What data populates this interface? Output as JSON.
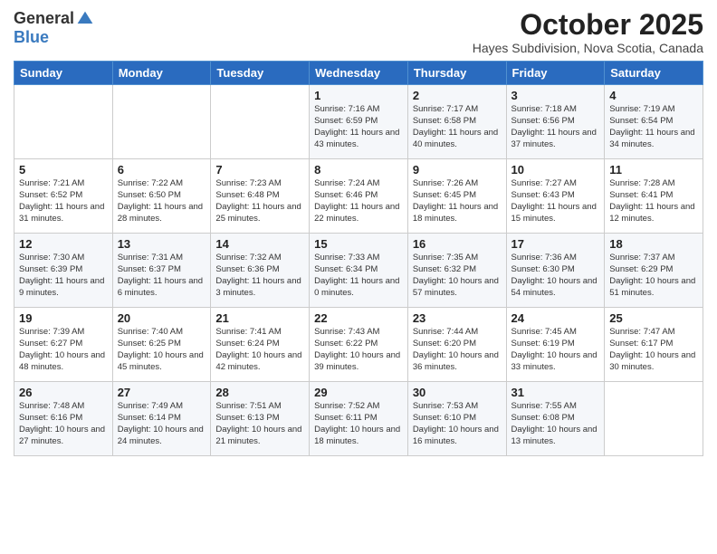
{
  "logo": {
    "general": "General",
    "blue": "Blue"
  },
  "title": "October 2025",
  "subtitle": "Hayes Subdivision, Nova Scotia, Canada",
  "days_of_week": [
    "Sunday",
    "Monday",
    "Tuesday",
    "Wednesday",
    "Thursday",
    "Friday",
    "Saturday"
  ],
  "weeks": [
    [
      {
        "day": "",
        "info": ""
      },
      {
        "day": "",
        "info": ""
      },
      {
        "day": "",
        "info": ""
      },
      {
        "day": "1",
        "info": "Sunrise: 7:16 AM\nSunset: 6:59 PM\nDaylight: 11 hours\nand 43 minutes."
      },
      {
        "day": "2",
        "info": "Sunrise: 7:17 AM\nSunset: 6:58 PM\nDaylight: 11 hours\nand 40 minutes."
      },
      {
        "day": "3",
        "info": "Sunrise: 7:18 AM\nSunset: 6:56 PM\nDaylight: 11 hours\nand 37 minutes."
      },
      {
        "day": "4",
        "info": "Sunrise: 7:19 AM\nSunset: 6:54 PM\nDaylight: 11 hours\nand 34 minutes."
      }
    ],
    [
      {
        "day": "5",
        "info": "Sunrise: 7:21 AM\nSunset: 6:52 PM\nDaylight: 11 hours\nand 31 minutes."
      },
      {
        "day": "6",
        "info": "Sunrise: 7:22 AM\nSunset: 6:50 PM\nDaylight: 11 hours\nand 28 minutes."
      },
      {
        "day": "7",
        "info": "Sunrise: 7:23 AM\nSunset: 6:48 PM\nDaylight: 11 hours\nand 25 minutes."
      },
      {
        "day": "8",
        "info": "Sunrise: 7:24 AM\nSunset: 6:46 PM\nDaylight: 11 hours\nand 22 minutes."
      },
      {
        "day": "9",
        "info": "Sunrise: 7:26 AM\nSunset: 6:45 PM\nDaylight: 11 hours\nand 18 minutes."
      },
      {
        "day": "10",
        "info": "Sunrise: 7:27 AM\nSunset: 6:43 PM\nDaylight: 11 hours\nand 15 minutes."
      },
      {
        "day": "11",
        "info": "Sunrise: 7:28 AM\nSunset: 6:41 PM\nDaylight: 11 hours\nand 12 minutes."
      }
    ],
    [
      {
        "day": "12",
        "info": "Sunrise: 7:30 AM\nSunset: 6:39 PM\nDaylight: 11 hours\nand 9 minutes."
      },
      {
        "day": "13",
        "info": "Sunrise: 7:31 AM\nSunset: 6:37 PM\nDaylight: 11 hours\nand 6 minutes."
      },
      {
        "day": "14",
        "info": "Sunrise: 7:32 AM\nSunset: 6:36 PM\nDaylight: 11 hours\nand 3 minutes."
      },
      {
        "day": "15",
        "info": "Sunrise: 7:33 AM\nSunset: 6:34 PM\nDaylight: 11 hours\nand 0 minutes."
      },
      {
        "day": "16",
        "info": "Sunrise: 7:35 AM\nSunset: 6:32 PM\nDaylight: 10 hours\nand 57 minutes."
      },
      {
        "day": "17",
        "info": "Sunrise: 7:36 AM\nSunset: 6:30 PM\nDaylight: 10 hours\nand 54 minutes."
      },
      {
        "day": "18",
        "info": "Sunrise: 7:37 AM\nSunset: 6:29 PM\nDaylight: 10 hours\nand 51 minutes."
      }
    ],
    [
      {
        "day": "19",
        "info": "Sunrise: 7:39 AM\nSunset: 6:27 PM\nDaylight: 10 hours\nand 48 minutes."
      },
      {
        "day": "20",
        "info": "Sunrise: 7:40 AM\nSunset: 6:25 PM\nDaylight: 10 hours\nand 45 minutes."
      },
      {
        "day": "21",
        "info": "Sunrise: 7:41 AM\nSunset: 6:24 PM\nDaylight: 10 hours\nand 42 minutes."
      },
      {
        "day": "22",
        "info": "Sunrise: 7:43 AM\nSunset: 6:22 PM\nDaylight: 10 hours\nand 39 minutes."
      },
      {
        "day": "23",
        "info": "Sunrise: 7:44 AM\nSunset: 6:20 PM\nDaylight: 10 hours\nand 36 minutes."
      },
      {
        "day": "24",
        "info": "Sunrise: 7:45 AM\nSunset: 6:19 PM\nDaylight: 10 hours\nand 33 minutes."
      },
      {
        "day": "25",
        "info": "Sunrise: 7:47 AM\nSunset: 6:17 PM\nDaylight: 10 hours\nand 30 minutes."
      }
    ],
    [
      {
        "day": "26",
        "info": "Sunrise: 7:48 AM\nSunset: 6:16 PM\nDaylight: 10 hours\nand 27 minutes."
      },
      {
        "day": "27",
        "info": "Sunrise: 7:49 AM\nSunset: 6:14 PM\nDaylight: 10 hours\nand 24 minutes."
      },
      {
        "day": "28",
        "info": "Sunrise: 7:51 AM\nSunset: 6:13 PM\nDaylight: 10 hours\nand 21 minutes."
      },
      {
        "day": "29",
        "info": "Sunrise: 7:52 AM\nSunset: 6:11 PM\nDaylight: 10 hours\nand 18 minutes."
      },
      {
        "day": "30",
        "info": "Sunrise: 7:53 AM\nSunset: 6:10 PM\nDaylight: 10 hours\nand 16 minutes."
      },
      {
        "day": "31",
        "info": "Sunrise: 7:55 AM\nSunset: 6:08 PM\nDaylight: 10 hours\nand 13 minutes."
      },
      {
        "day": "",
        "info": ""
      }
    ]
  ]
}
